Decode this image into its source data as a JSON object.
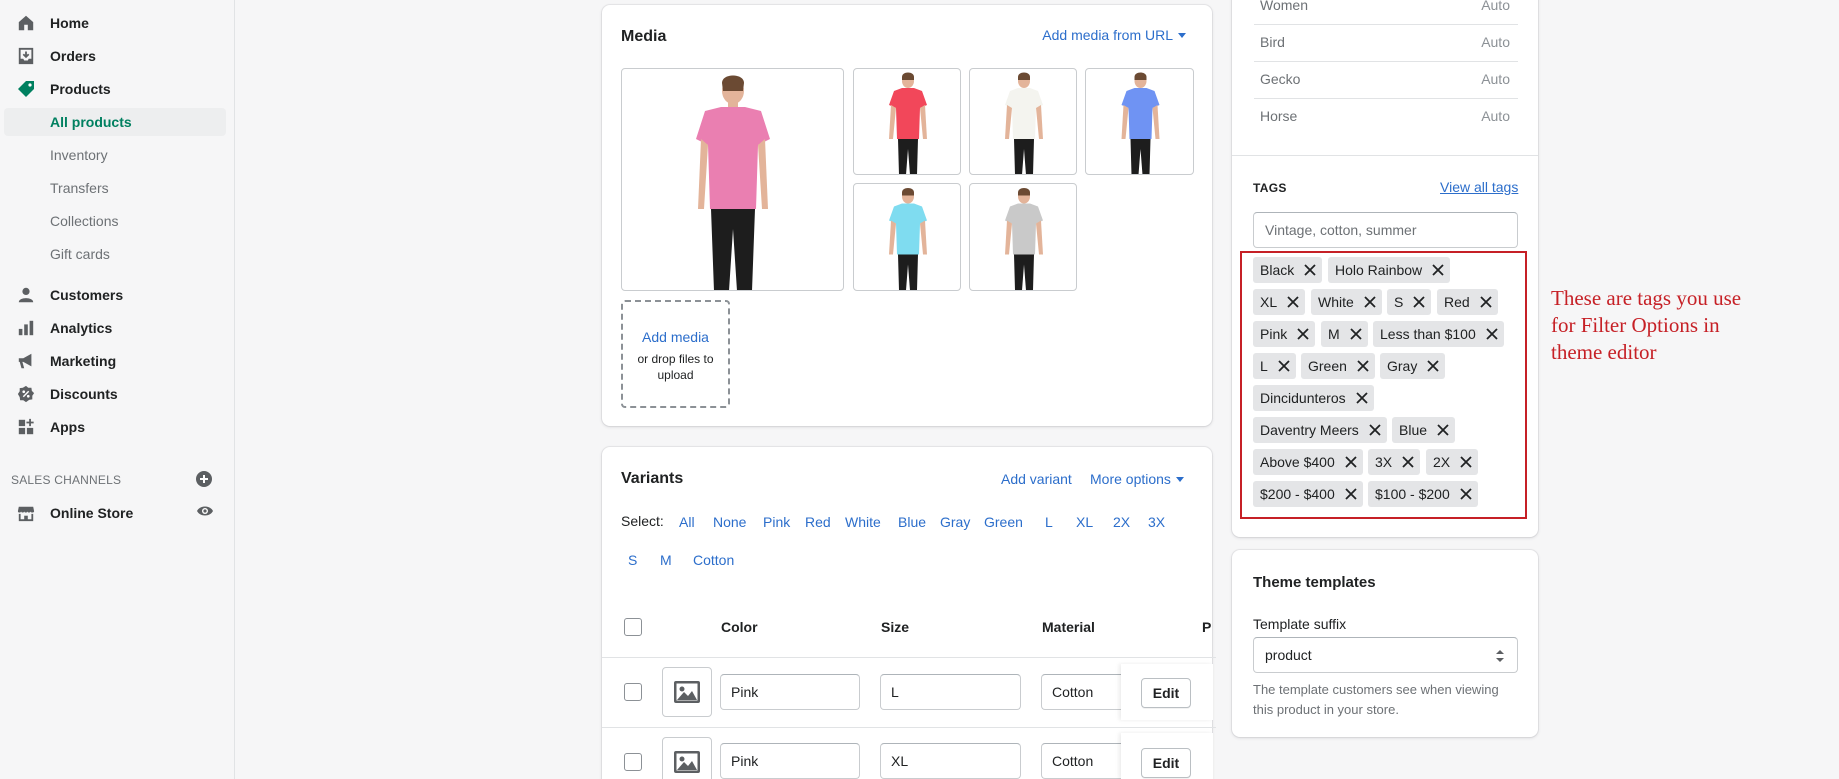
{
  "sidebar": {
    "items": [
      {
        "label": "Home",
        "icon": "home-icon"
      },
      {
        "label": "Orders",
        "icon": "orders-icon"
      },
      {
        "label": "Products",
        "icon": "products-tag-icon"
      },
      {
        "label": "Customers",
        "icon": "customers-icon"
      },
      {
        "label": "Analytics",
        "icon": "analytics-icon"
      },
      {
        "label": "Marketing",
        "icon": "marketing-icon"
      },
      {
        "label": "Discounts",
        "icon": "discounts-icon"
      },
      {
        "label": "Apps",
        "icon": "apps-icon"
      }
    ],
    "product_subitems": [
      "All products",
      "Inventory",
      "Transfers",
      "Collections",
      "Gift cards"
    ],
    "sales_channels_title": "SALES CHANNELS",
    "online_store": "Online Store"
  },
  "media": {
    "title": "Media",
    "add_from_url": "Add media from URL",
    "add_media": "Add media",
    "drop_hint": "or drop files to upload",
    "thumb_colors": [
      "#ea7fb1",
      "#f2475a",
      "#f4f4ef",
      "#6f93f3",
      "#7fdcf0",
      "#c9c9c9"
    ]
  },
  "variants": {
    "title": "Variants",
    "add_variant": "Add variant",
    "more_options": "More options",
    "select_label": "Select:",
    "select_options": [
      "All",
      "None",
      "Pink",
      "Red",
      "White",
      "Blue",
      "Gray",
      "Green",
      "L",
      "XL",
      "2X",
      "3X",
      "S",
      "M",
      "Cotton"
    ],
    "columns": {
      "color": "Color",
      "size": "Size",
      "material": "Material",
      "price_partial": "P"
    },
    "rows": [
      {
        "color": "Pink",
        "size": "L",
        "material": "Cotton",
        "edit": "Edit"
      },
      {
        "color": "Pink",
        "size": "XL",
        "material": "Cotton",
        "edit": "Edit"
      }
    ]
  },
  "collections": [
    {
      "name": "Women",
      "mode": "Auto"
    },
    {
      "name": "Bird",
      "mode": "Auto"
    },
    {
      "name": "Gecko",
      "mode": "Auto"
    },
    {
      "name": "Horse",
      "mode": "Auto"
    }
  ],
  "tags": {
    "title": "TAGS",
    "view_all": "View all tags",
    "placeholder": "Vintage, cotton, summer",
    "rows": [
      [
        "Black",
        "Holo Rainbow"
      ],
      [
        "XL",
        "White",
        "S",
        "Red"
      ],
      [
        "Pink",
        "M",
        "Less than $100"
      ],
      [
        "L",
        "Green",
        "Gray"
      ],
      [
        "Dincidunteros"
      ],
      [
        "Daventry Meers",
        "Blue"
      ],
      [
        "Above $400",
        "3X",
        "2X"
      ],
      [
        "$200 - $400",
        "$100 - $200"
      ]
    ]
  },
  "annotation": {
    "lines": [
      "These are tags you use",
      "for Filter Options in",
      "theme editor"
    ]
  },
  "theme": {
    "title": "Theme templates",
    "suffix_label": "Template suffix",
    "suffix_value": "product",
    "help_lines": [
      "The template customers see when viewing",
      "this product in your store."
    ]
  },
  "colors": {
    "accent_green": "#008060",
    "link_blue": "#2c6ecb",
    "annotation_red": "#c62026"
  }
}
